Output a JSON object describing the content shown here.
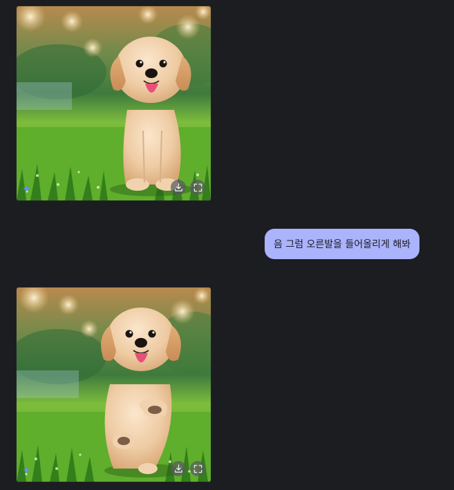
{
  "conversation": {
    "messages": [
      {
        "role": "assistant",
        "type": "image",
        "alt": "",
        "actions": [
          "download-icon",
          "fullscreen-icon"
        ]
      },
      {
        "role": "user",
        "type": "text",
        "text": "음 그럼 오른발을 들어올리게 해봐"
      },
      {
        "role": "assistant",
        "type": "image",
        "alt": "",
        "actions": [
          "download-icon",
          "fullscreen-icon"
        ]
      }
    ]
  },
  "colors": {
    "background": "#1c1d21",
    "user_bubble": "#aab3fb",
    "user_text": "#1b1c24",
    "image_button": "#5a5a5f"
  }
}
